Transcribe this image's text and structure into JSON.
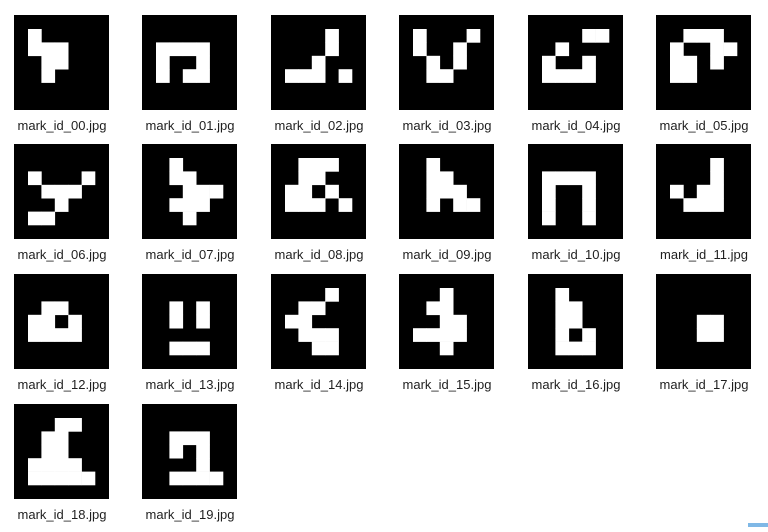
{
  "files": [
    {
      "name": "mark_id_00.jpg",
      "icon": "aruco-marker-00-icon",
      "pattern": [
        "10000",
        "11100",
        "01100",
        "01000",
        "00000"
      ]
    },
    {
      "name": "mark_id_01.jpg",
      "icon": "aruco-marker-01-icon",
      "pattern": [
        "00000",
        "11110",
        "10010",
        "10110",
        "00000"
      ]
    },
    {
      "name": "mark_id_02.jpg",
      "icon": "aruco-marker-02-icon",
      "pattern": [
        "00010",
        "00010",
        "00100",
        "11101",
        "00000"
      ]
    },
    {
      "name": "mark_id_03.jpg",
      "icon": "aruco-marker-03-icon",
      "pattern": [
        "10001",
        "10010",
        "01010",
        "01100",
        "00000"
      ]
    },
    {
      "name": "mark_id_04.jpg",
      "icon": "aruco-marker-04-icon",
      "pattern": [
        "00011",
        "01000",
        "10010",
        "11110",
        "00000"
      ]
    },
    {
      "name": "mark_id_05.jpg",
      "icon": "aruco-marker-05-icon",
      "pattern": [
        "01110",
        "10011",
        "11010",
        "11000",
        "00000"
      ]
    },
    {
      "name": "mark_id_06.jpg",
      "icon": "aruco-marker-06-icon",
      "pattern": [
        "00000",
        "10001",
        "01110",
        "00100",
        "11000"
      ]
    },
    {
      "name": "mark_id_07.jpg",
      "icon": "aruco-marker-07-icon",
      "pattern": [
        "01000",
        "01100",
        "00111",
        "01110",
        "00100"
      ]
    },
    {
      "name": "mark_id_08.jpg",
      "icon": "aruco-marker-08-icon",
      "pattern": [
        "01110",
        "01100",
        "11010",
        "11101",
        "00000"
      ]
    },
    {
      "name": "mark_id_09.jpg",
      "icon": "aruco-marker-09-icon",
      "pattern": [
        "01000",
        "01100",
        "01110",
        "01011",
        "00000"
      ]
    },
    {
      "name": "mark_id_10.jpg",
      "icon": "aruco-marker-10-icon",
      "pattern": [
        "00000",
        "11110",
        "10010",
        "10010",
        "10010"
      ]
    },
    {
      "name": "mark_id_11.jpg",
      "icon": "aruco-marker-11-icon",
      "pattern": [
        "00010",
        "00010",
        "10110",
        "01110",
        "00000"
      ]
    },
    {
      "name": "mark_id_12.jpg",
      "icon": "aruco-marker-12-icon",
      "pattern": [
        "00000",
        "01100",
        "11010",
        "11110",
        "00000"
      ]
    },
    {
      "name": "mark_id_13.jpg",
      "icon": "aruco-marker-13-icon",
      "pattern": [
        "00000",
        "01010",
        "01010",
        "00000",
        "01110"
      ]
    },
    {
      "name": "mark_id_14.jpg",
      "icon": "aruco-marker-14-icon",
      "pattern": [
        "00010",
        "01100",
        "11000",
        "01110",
        "00110"
      ]
    },
    {
      "name": "mark_id_15.jpg",
      "icon": "aruco-marker-15-icon",
      "pattern": [
        "00100",
        "01100",
        "00110",
        "11110",
        "00100"
      ]
    },
    {
      "name": "mark_id_16.jpg",
      "icon": "aruco-marker-16-icon",
      "pattern": [
        "01000",
        "01100",
        "01100",
        "01010",
        "01110"
      ]
    },
    {
      "name": "mark_id_17.jpg",
      "icon": "aruco-marker-17-icon",
      "pattern": [
        "00000",
        "00000",
        "00110",
        "00110",
        "00000"
      ]
    },
    {
      "name": "mark_id_18.jpg",
      "icon": "aruco-marker-18-icon",
      "pattern": [
        "00110",
        "01100",
        "01100",
        "11110",
        "11111"
      ]
    },
    {
      "name": "mark_id_19.jpg",
      "icon": "aruco-marker-19-icon",
      "pattern": [
        "00000",
        "01110",
        "01010",
        "00010",
        "01111"
      ]
    }
  ],
  "colors": {
    "thumb_background": "#000000",
    "thumb_cell": "#ffffff",
    "label_text": "#1f1f1f",
    "scroll_indicator": "#7fb8e6"
  }
}
